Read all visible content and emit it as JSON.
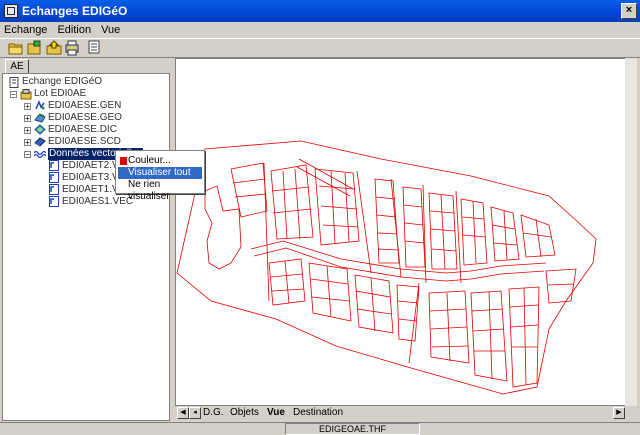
{
  "window": {
    "title": "Echanges EDIGéO",
    "close_glyph": "×"
  },
  "menu": [
    "Echange",
    "Edition",
    "Vue"
  ],
  "toolbar": [
    "open-folder-icon",
    "save-icon",
    "export-icon",
    "print-icon",
    "settings-icon"
  ],
  "left_tab": "AE",
  "tree": {
    "root": "Echange EDIGéO",
    "lot": "Lot EDI0AE",
    "files": [
      "EDI0AESE.GEN",
      "EDI0AESE.GEO",
      "EDI0AESE.DIC",
      "EDI0AESE.SCD"
    ],
    "vector_group": "Données vectorielles",
    "vector_items": [
      "EDI0AET2.VEC",
      "EDI0AET3.VEC",
      "EDI0AET1.VEC",
      "EDI0AES1.VEC"
    ]
  },
  "context_menu": {
    "items": [
      "Couleur...",
      "Visualiser tout",
      "Ne rien visualiser"
    ],
    "highlighted": "Visualiser tout"
  },
  "bottom_tabs": [
    "D.G.",
    "Objets",
    "Vue",
    "Destination"
  ],
  "active_bottom_tab": "Vue",
  "status": {
    "file": "EDIGEOAE.THF"
  },
  "colors": {
    "title_bar": "#0046d4",
    "map_lines": "#e00000",
    "selection": "#0a246a",
    "menu_highlight": "#316ac5"
  }
}
